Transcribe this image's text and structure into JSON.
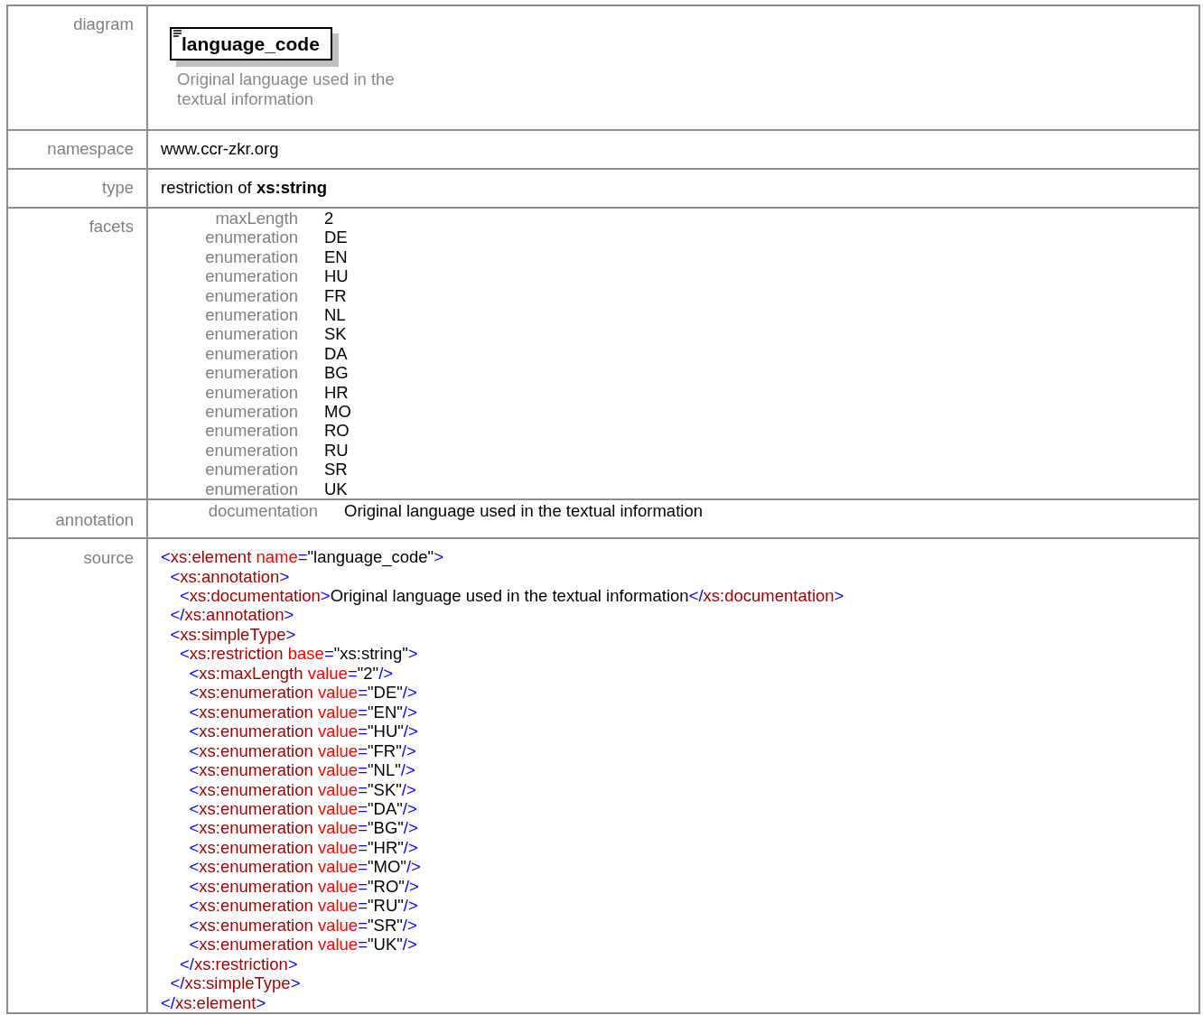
{
  "diagram": {
    "label": "diagram",
    "element_name": "language_code",
    "description": "Original language used in the textual information"
  },
  "namespace": {
    "label": "namespace",
    "value": "www.ccr-zkr.org"
  },
  "type": {
    "label": "type",
    "value": "restriction of **xs:string**"
  },
  "facets": {
    "label": "facets",
    "items": [
      {
        "name": "maxLength",
        "value": "2"
      },
      {
        "name": "enumeration",
        "value": "DE"
      },
      {
        "name": "enumeration",
        "value": "EN"
      },
      {
        "name": "enumeration",
        "value": "HU"
      },
      {
        "name": "enumeration",
        "value": "FR"
      },
      {
        "name": "enumeration",
        "value": "NL"
      },
      {
        "name": "enumeration",
        "value": "SK"
      },
      {
        "name": "enumeration",
        "value": "DA"
      },
      {
        "name": "enumeration",
        "value": "BG"
      },
      {
        "name": "enumeration",
        "value": "HR"
      },
      {
        "name": "enumeration",
        "value": "MO"
      },
      {
        "name": "enumeration",
        "value": "RO"
      },
      {
        "name": "enumeration",
        "value": "RU"
      },
      {
        "name": "enumeration",
        "value": "SR"
      },
      {
        "name": "enumeration",
        "value": "UK"
      }
    ]
  },
  "annotation": {
    "label": "annotation",
    "items": [
      {
        "name": "documentation",
        "value": "Original language used in the textual information"
      }
    ]
  },
  "source": {
    "label": "source",
    "code": [
      {
        "open": [
          {
            "kind": "punct",
            "text": "<"
          },
          {
            "kind": "tag",
            "text": "xs:element"
          },
          {
            "kind": "attr",
            "text": " name"
          },
          {
            "kind": "punct",
            "text": "="
          },
          {
            "kind": "value",
            "text": "\"language_code\""
          },
          {
            "kind": "punct",
            "text": ">"
          }
        ],
        "children": [
          {
            "open": [
              {
                "kind": "punct",
                "text": "<"
              },
              {
                "kind": "tag",
                "text": "xs:annotation"
              },
              {
                "kind": "punct",
                "text": ">"
              }
            ],
            "children": [
              {
                "open": [
                  {
                    "kind": "punct",
                    "text": "<"
                  },
                  {
                    "kind": "tag",
                    "text": "xs:documentation"
                  },
                  {
                    "kind": "punct",
                    "text": ">"
                  },
                  {
                    "kind": "value",
                    "text": "Original language used in the textual information"
                  },
                  {
                    "kind": "punct",
                    "text": "</"
                  },
                  {
                    "kind": "tag",
                    "text": "xs:documentation"
                  },
                  {
                    "kind": "punct",
                    "text": ">"
                  }
                ]
              }
            ],
            "close": [
              {
                "kind": "punct",
                "text": "</"
              },
              {
                "kind": "tag",
                "text": "xs:annotation"
              },
              {
                "kind": "punct",
                "text": ">"
              }
            ]
          },
          {
            "open": [
              {
                "kind": "punct",
                "text": "<"
              },
              {
                "kind": "tag",
                "text": "xs:simpleType"
              },
              {
                "kind": "punct",
                "text": ">"
              }
            ],
            "children": [
              {
                "open": [
                  {
                    "kind": "punct",
                    "text": "<"
                  },
                  {
                    "kind": "tag",
                    "text": "xs:restriction"
                  },
                  {
                    "kind": "attr",
                    "text": " base"
                  },
                  {
                    "kind": "punct",
                    "text": "="
                  },
                  {
                    "kind": "value",
                    "text": "\"xs:string\""
                  },
                  {
                    "kind": "punct",
                    "text": ">"
                  }
                ],
                "children": [
                  {
                    "open": [
                      {
                        "kind": "punct",
                        "text": "<"
                      },
                      {
                        "kind": "tag",
                        "text": "xs:maxLength"
                      },
                      {
                        "kind": "attr",
                        "text": " value"
                      },
                      {
                        "kind": "punct",
                        "text": "="
                      },
                      {
                        "kind": "value",
                        "text": "\"2\""
                      },
                      {
                        "kind": "punct",
                        "text": "/>"
                      }
                    ]
                  },
                  {
                    "open": [
                      {
                        "kind": "punct",
                        "text": "<"
                      },
                      {
                        "kind": "tag",
                        "text": "xs:enumeration"
                      },
                      {
                        "kind": "attr",
                        "text": " value"
                      },
                      {
                        "kind": "punct",
                        "text": "="
                      },
                      {
                        "kind": "value",
                        "text": "\"DE\""
                      },
                      {
                        "kind": "punct",
                        "text": "/>"
                      }
                    ]
                  },
                  {
                    "open": [
                      {
                        "kind": "punct",
                        "text": "<"
                      },
                      {
                        "kind": "tag",
                        "text": "xs:enumeration"
                      },
                      {
                        "kind": "attr",
                        "text": " value"
                      },
                      {
                        "kind": "punct",
                        "text": "="
                      },
                      {
                        "kind": "value",
                        "text": "\"EN\""
                      },
                      {
                        "kind": "punct",
                        "text": "/>"
                      }
                    ]
                  },
                  {
                    "open": [
                      {
                        "kind": "punct",
                        "text": "<"
                      },
                      {
                        "kind": "tag",
                        "text": "xs:enumeration"
                      },
                      {
                        "kind": "attr",
                        "text": " value"
                      },
                      {
                        "kind": "punct",
                        "text": "="
                      },
                      {
                        "kind": "value",
                        "text": "\"HU\""
                      },
                      {
                        "kind": "punct",
                        "text": "/>"
                      }
                    ]
                  },
                  {
                    "open": [
                      {
                        "kind": "punct",
                        "text": "<"
                      },
                      {
                        "kind": "tag",
                        "text": "xs:enumeration"
                      },
                      {
                        "kind": "attr",
                        "text": " value"
                      },
                      {
                        "kind": "punct",
                        "text": "="
                      },
                      {
                        "kind": "value",
                        "text": "\"FR\""
                      },
                      {
                        "kind": "punct",
                        "text": "/>"
                      }
                    ]
                  },
                  {
                    "open": [
                      {
                        "kind": "punct",
                        "text": "<"
                      },
                      {
                        "kind": "tag",
                        "text": "xs:enumeration"
                      },
                      {
                        "kind": "attr",
                        "text": " value"
                      },
                      {
                        "kind": "punct",
                        "text": "="
                      },
                      {
                        "kind": "value",
                        "text": "\"NL\""
                      },
                      {
                        "kind": "punct",
                        "text": "/>"
                      }
                    ]
                  },
                  {
                    "open": [
                      {
                        "kind": "punct",
                        "text": "<"
                      },
                      {
                        "kind": "tag",
                        "text": "xs:enumeration"
                      },
                      {
                        "kind": "attr",
                        "text": " value"
                      },
                      {
                        "kind": "punct",
                        "text": "="
                      },
                      {
                        "kind": "value",
                        "text": "\"SK\""
                      },
                      {
                        "kind": "punct",
                        "text": "/>"
                      }
                    ]
                  },
                  {
                    "open": [
                      {
                        "kind": "punct",
                        "text": "<"
                      },
                      {
                        "kind": "tag",
                        "text": "xs:enumeration"
                      },
                      {
                        "kind": "attr",
                        "text": " value"
                      },
                      {
                        "kind": "punct",
                        "text": "="
                      },
                      {
                        "kind": "value",
                        "text": "\"DA\""
                      },
                      {
                        "kind": "punct",
                        "text": "/>"
                      }
                    ]
                  },
                  {
                    "open": [
                      {
                        "kind": "punct",
                        "text": "<"
                      },
                      {
                        "kind": "tag",
                        "text": "xs:enumeration"
                      },
                      {
                        "kind": "attr",
                        "text": " value"
                      },
                      {
                        "kind": "punct",
                        "text": "="
                      },
                      {
                        "kind": "value",
                        "text": "\"BG\""
                      },
                      {
                        "kind": "punct",
                        "text": "/>"
                      }
                    ]
                  },
                  {
                    "open": [
                      {
                        "kind": "punct",
                        "text": "<"
                      },
                      {
                        "kind": "tag",
                        "text": "xs:enumeration"
                      },
                      {
                        "kind": "attr",
                        "text": " value"
                      },
                      {
                        "kind": "punct",
                        "text": "="
                      },
                      {
                        "kind": "value",
                        "text": "\"HR\""
                      },
                      {
                        "kind": "punct",
                        "text": "/>"
                      }
                    ]
                  },
                  {
                    "open": [
                      {
                        "kind": "punct",
                        "text": "<"
                      },
                      {
                        "kind": "tag",
                        "text": "xs:enumeration"
                      },
                      {
                        "kind": "attr",
                        "text": " value"
                      },
                      {
                        "kind": "punct",
                        "text": "="
                      },
                      {
                        "kind": "value",
                        "text": "\"MO\""
                      },
                      {
                        "kind": "punct",
                        "text": "/>"
                      }
                    ]
                  },
                  {
                    "open": [
                      {
                        "kind": "punct",
                        "text": "<"
                      },
                      {
                        "kind": "tag",
                        "text": "xs:enumeration"
                      },
                      {
                        "kind": "attr",
                        "text": " value"
                      },
                      {
                        "kind": "punct",
                        "text": "="
                      },
                      {
                        "kind": "value",
                        "text": "\"RO\""
                      },
                      {
                        "kind": "punct",
                        "text": "/>"
                      }
                    ]
                  },
                  {
                    "open": [
                      {
                        "kind": "punct",
                        "text": "<"
                      },
                      {
                        "kind": "tag",
                        "text": "xs:enumeration"
                      },
                      {
                        "kind": "attr",
                        "text": " value"
                      },
                      {
                        "kind": "punct",
                        "text": "="
                      },
                      {
                        "kind": "value",
                        "text": "\"RU\""
                      },
                      {
                        "kind": "punct",
                        "text": "/>"
                      }
                    ]
                  },
                  {
                    "open": [
                      {
                        "kind": "punct",
                        "text": "<"
                      },
                      {
                        "kind": "tag",
                        "text": "xs:enumeration"
                      },
                      {
                        "kind": "attr",
                        "text": " value"
                      },
                      {
                        "kind": "punct",
                        "text": "="
                      },
                      {
                        "kind": "value",
                        "text": "\"SR\""
                      },
                      {
                        "kind": "punct",
                        "text": "/>"
                      }
                    ]
                  },
                  {
                    "open": [
                      {
                        "kind": "punct",
                        "text": "<"
                      },
                      {
                        "kind": "tag",
                        "text": "xs:enumeration"
                      },
                      {
                        "kind": "attr",
                        "text": " value"
                      },
                      {
                        "kind": "punct",
                        "text": "="
                      },
                      {
                        "kind": "value",
                        "text": "\"UK\""
                      },
                      {
                        "kind": "punct",
                        "text": "/>"
                      }
                    ]
                  }
                ],
                "close": [
                  {
                    "kind": "punct",
                    "text": "</"
                  },
                  {
                    "kind": "tag",
                    "text": "xs:restriction"
                  },
                  {
                    "kind": "punct",
                    "text": ">"
                  }
                ]
              }
            ],
            "close": [
              {
                "kind": "punct",
                "text": "</"
              },
              {
                "kind": "tag",
                "text": "xs:simpleType"
              },
              {
                "kind": "punct",
                "text": ">"
              }
            ]
          }
        ],
        "close": [
          {
            "kind": "punct",
            "text": "</"
          },
          {
            "kind": "tag",
            "text": "xs:element"
          },
          {
            "kind": "punct",
            "text": ">"
          }
        ]
      }
    ]
  }
}
